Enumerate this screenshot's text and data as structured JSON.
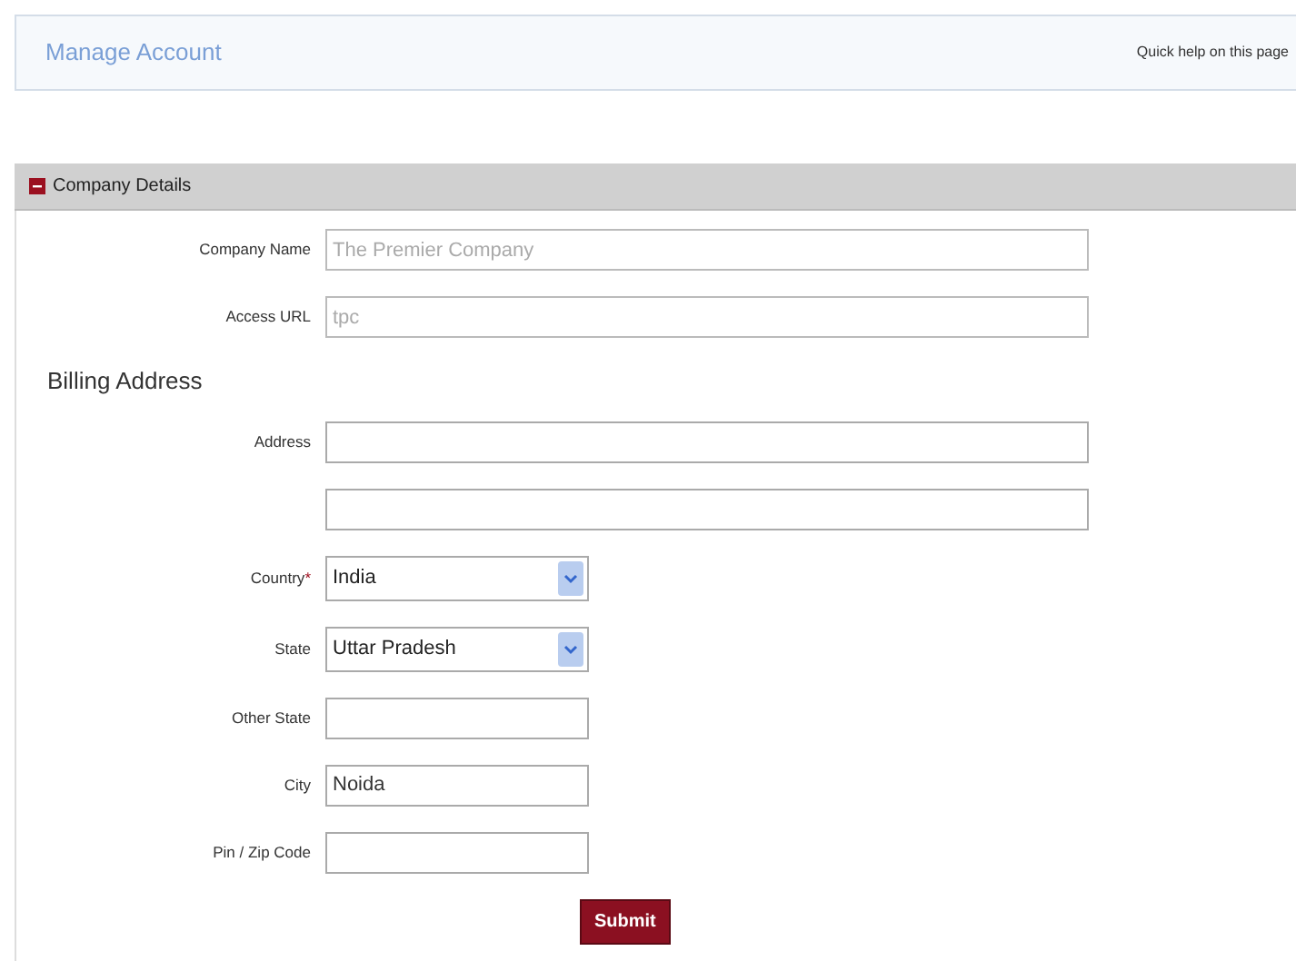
{
  "header": {
    "title": "Manage Account",
    "help_link": "Quick help on this page"
  },
  "section": {
    "title": "Company Details",
    "expanded": true
  },
  "form": [
    {
      "kind": "wide_field",
      "label": "Company Name",
      "value": "The Premier Company",
      "disabled": true
    },
    {
      "kind": "wide_field",
      "label": "Access URL",
      "value": "tpc",
      "disabled": true
    },
    {
      "kind": "heading",
      "label": "Billing Address"
    },
    {
      "kind": "wide_field",
      "label": "Address",
      "disabled": false
    },
    {
      "kind": "wide_field",
      "disabled": false
    },
    {
      "kind": "select",
      "label": "Country",
      "required_mark": "*",
      "value": "India"
    },
    {
      "kind": "select",
      "label": "State",
      "value": "Uttar Pradesh"
    },
    {
      "kind": "short_field",
      "label": "Other State",
      "disabled": false
    },
    {
      "kind": "short_field",
      "label": "City",
      "value": "Noida",
      "disabled": false
    },
    {
      "kind": "short_field",
      "label": "Pin / Zip Code",
      "disabled": false
    }
  ],
  "submit": "Submit"
}
